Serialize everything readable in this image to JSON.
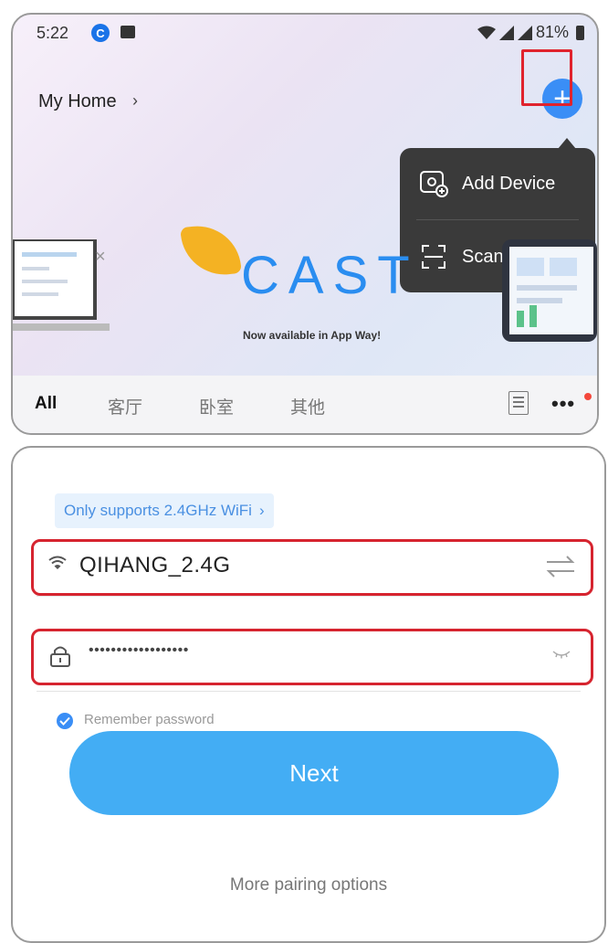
{
  "status_bar": {
    "time": "5:22",
    "battery": "81%"
  },
  "home": {
    "title": "My Home",
    "chevron": "›"
  },
  "add_menu": {
    "items": [
      {
        "label": "Add Device",
        "icon": "add-device-icon"
      },
      {
        "label": "Scan",
        "icon": "scan-icon"
      }
    ]
  },
  "banner": {
    "logo_text": "CAST",
    "subtitle": "Now available in App Way!",
    "close": "×"
  },
  "tabs": {
    "items": [
      {
        "label": "All",
        "active": true
      },
      {
        "label": "客厅",
        "active": false
      },
      {
        "label": "卧室",
        "active": false
      },
      {
        "label": "其他",
        "active": false
      }
    ],
    "more": "•••"
  },
  "wifi": {
    "hint": "Only supports 2.4GHz WiFi",
    "hint_chevron": "›",
    "ssid": "QIHANG_2.4G",
    "password_masked": "••••••••••••••••••",
    "remember_label": "Remember password",
    "remember_checked": true
  },
  "actions": {
    "next_label": "Next",
    "more_options_label": "More pairing options"
  },
  "colors": {
    "accent": "#3a8ef6",
    "next_button": "#43adf4",
    "highlight": "#d6242f",
    "menu_bg": "#3a3a3a"
  }
}
